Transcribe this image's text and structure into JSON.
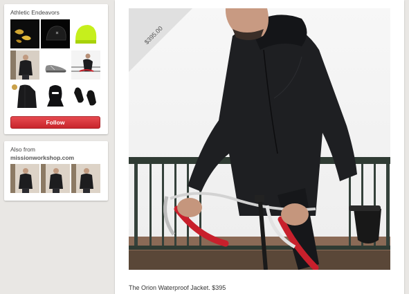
{
  "board": {
    "title": "Athletic Endeavors",
    "follow_label": "Follow",
    "pins": [
      {
        "name": "gloves-pin"
      },
      {
        "name": "black-hat-pin"
      },
      {
        "name": "yellow-beanie-pin"
      },
      {
        "name": "man-jacket-pin"
      },
      {
        "name": "sneaker-pin"
      },
      {
        "name": "cyclist-pin"
      },
      {
        "name": "jacket-pin"
      },
      {
        "name": "balaclava-pin"
      },
      {
        "name": "glove-pair-pin"
      }
    ]
  },
  "also_from": {
    "label": "Also from",
    "source": "missionworkshop.com"
  },
  "main_pin": {
    "price": "$395.00",
    "caption": "The Orion Waterproof Jacket. $395"
  },
  "colors": {
    "follow_button": "#cb2027",
    "background": "#e9e7e4"
  }
}
